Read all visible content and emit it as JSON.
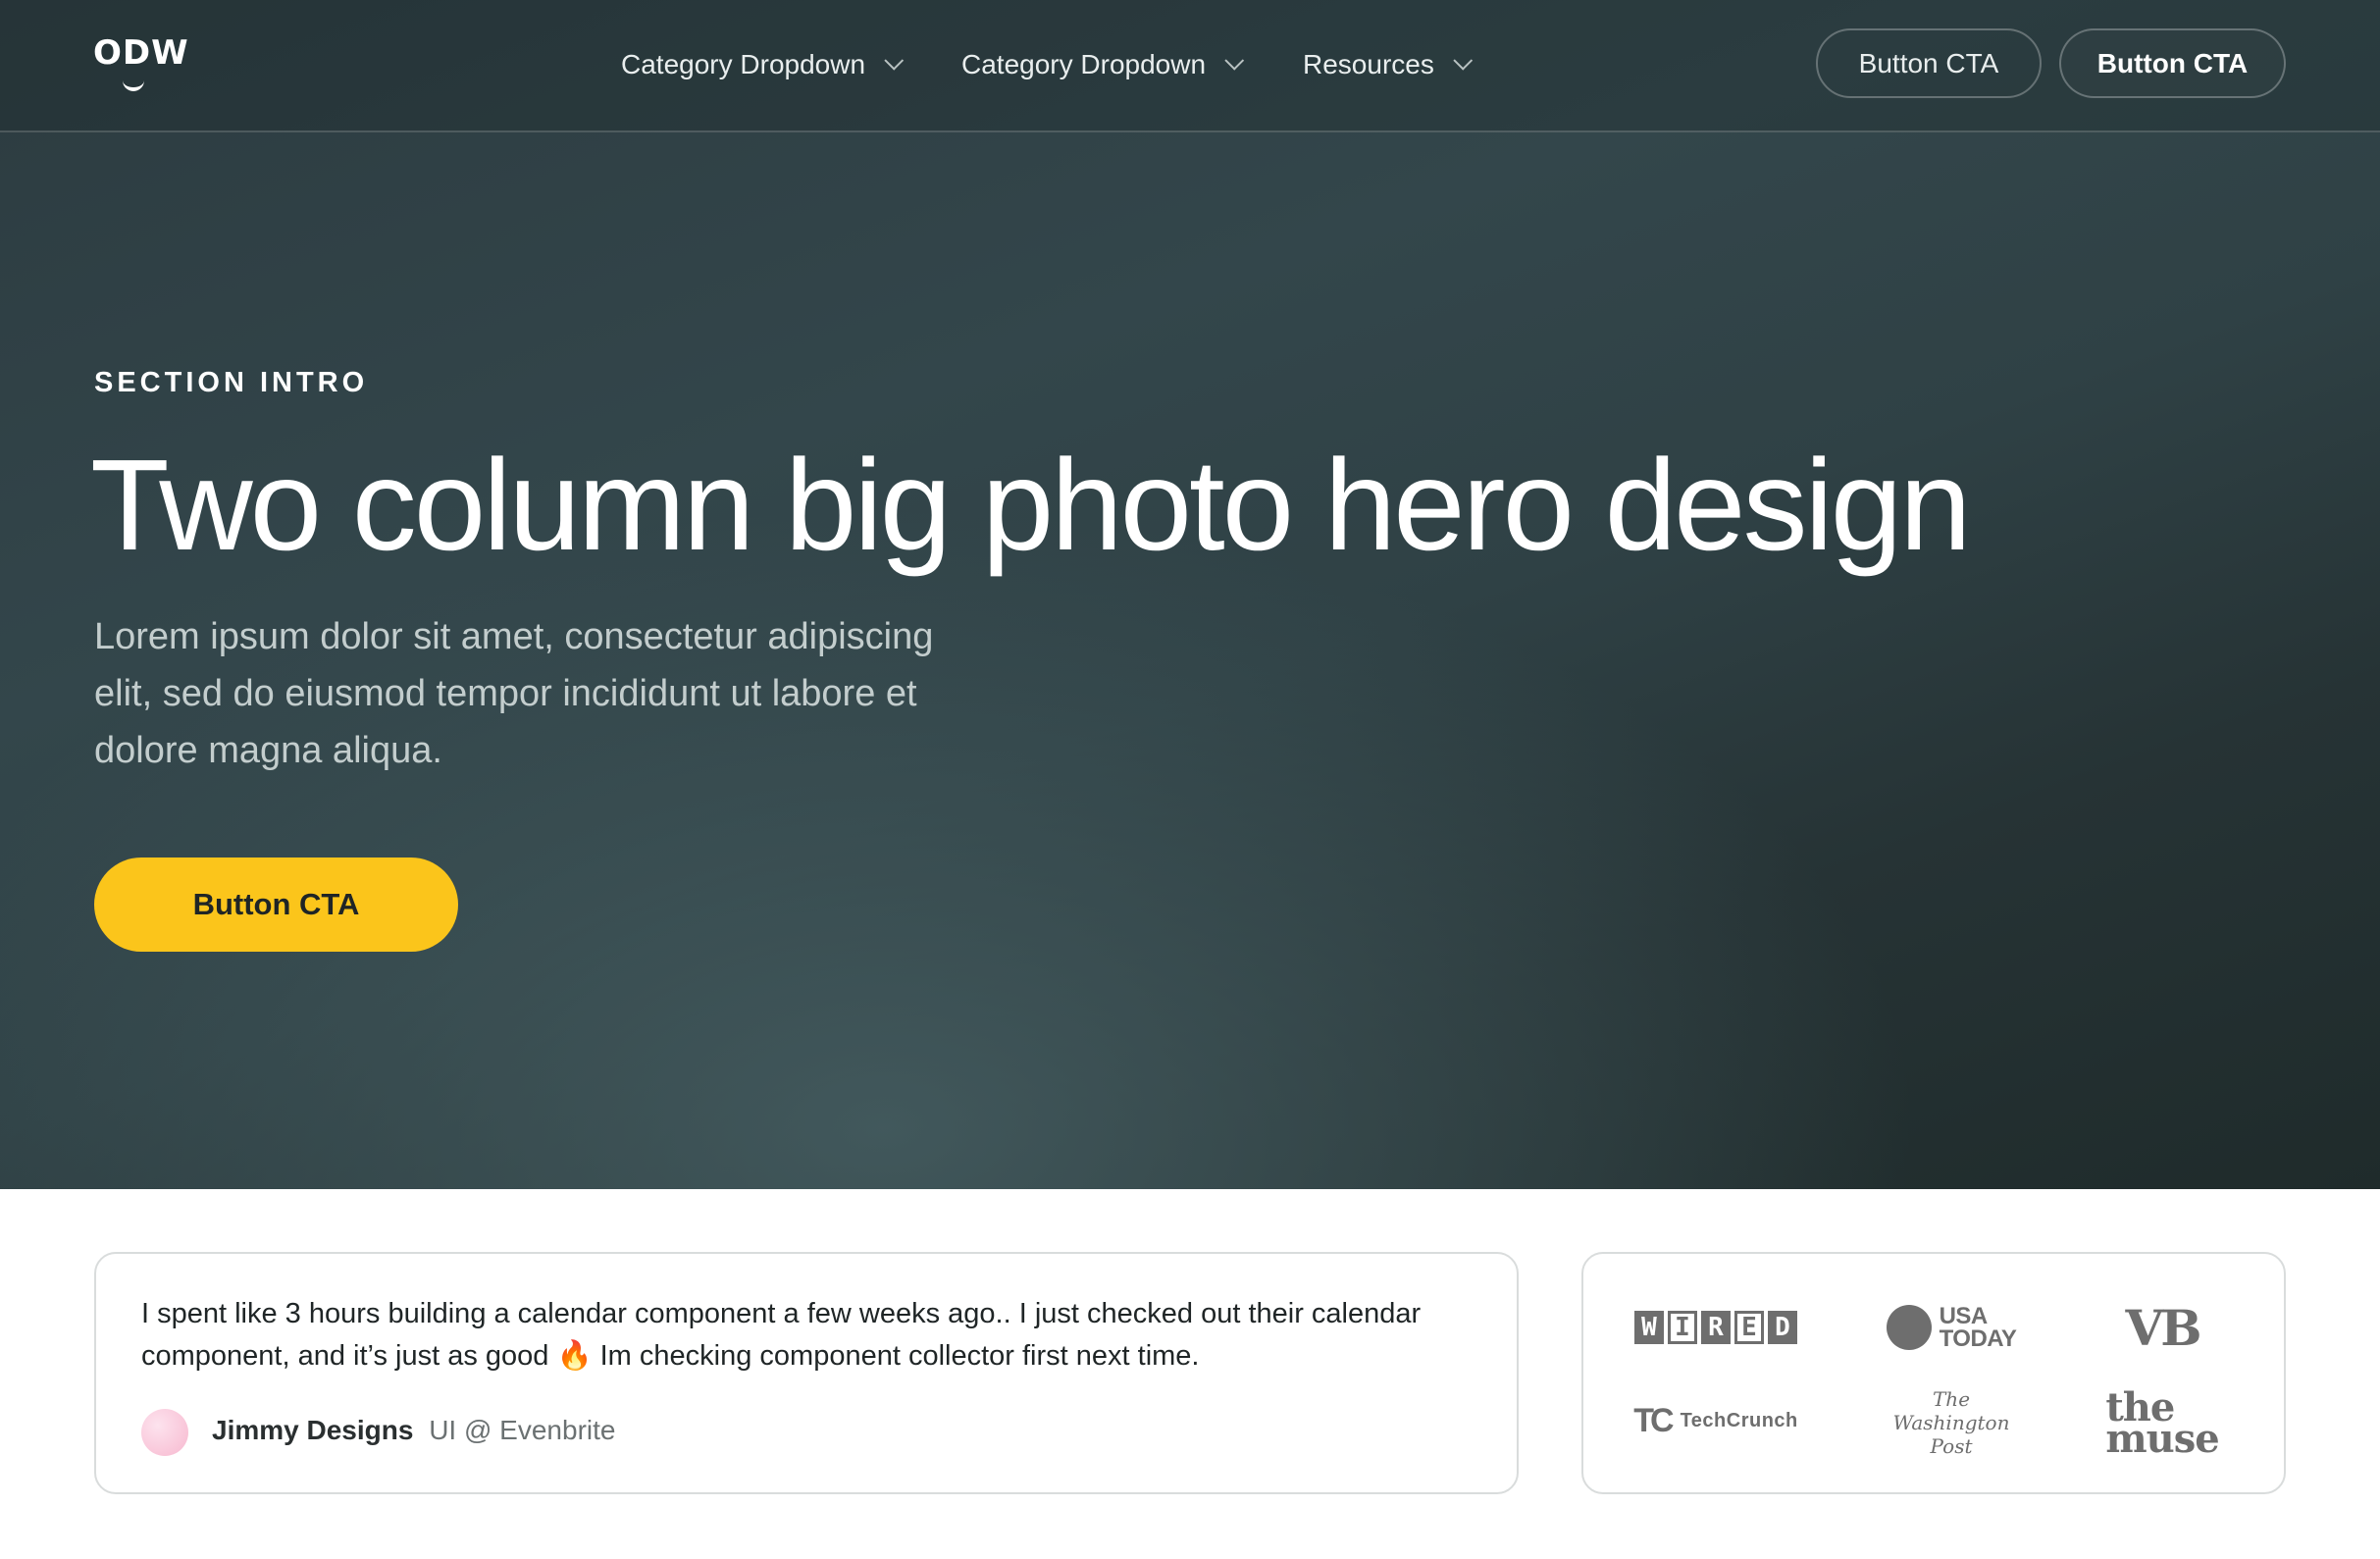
{
  "nav": {
    "logo": "ODW",
    "items": [
      {
        "label": "Category Dropdown"
      },
      {
        "label": "Category Dropdown"
      },
      {
        "label": "Resources"
      }
    ],
    "cta_outline": "Button CTA",
    "cta_solid": "Button CTA"
  },
  "hero": {
    "eyebrow": "SECTION INTRO",
    "headline": "Two column big photo hero design",
    "lede": "Lorem ipsum dolor sit amet, consectetur adipiscing elit, sed do eiusmod tempor incididunt ut labore et dolore magna aliqua.",
    "cta": "Button CTA"
  },
  "testimonial": {
    "quote": "I spent like 3 hours building a calendar component a few weeks ago.. I just checked out their calendar component, and it’s just as good 🔥 Im checking component collector first next time.",
    "author_name": "Jimmy Designs",
    "author_role": "UI @ Evenbrite"
  },
  "press_logos": {
    "wired": [
      "W",
      "I",
      "R",
      "E",
      "D"
    ],
    "usa_today": [
      "USA",
      "TODAY"
    ],
    "vb": "VB",
    "techcrunch_mark": "TC",
    "techcrunch": "TechCrunch",
    "washington_post": [
      "The",
      "Washington",
      "Post"
    ],
    "the_muse": [
      "the",
      "muse"
    ]
  },
  "colors": {
    "accent": "#fbc51b",
    "hero_dark": "#1f2b2b",
    "hero_light": "#465e62",
    "logo_gray": "#6e6e6e"
  }
}
